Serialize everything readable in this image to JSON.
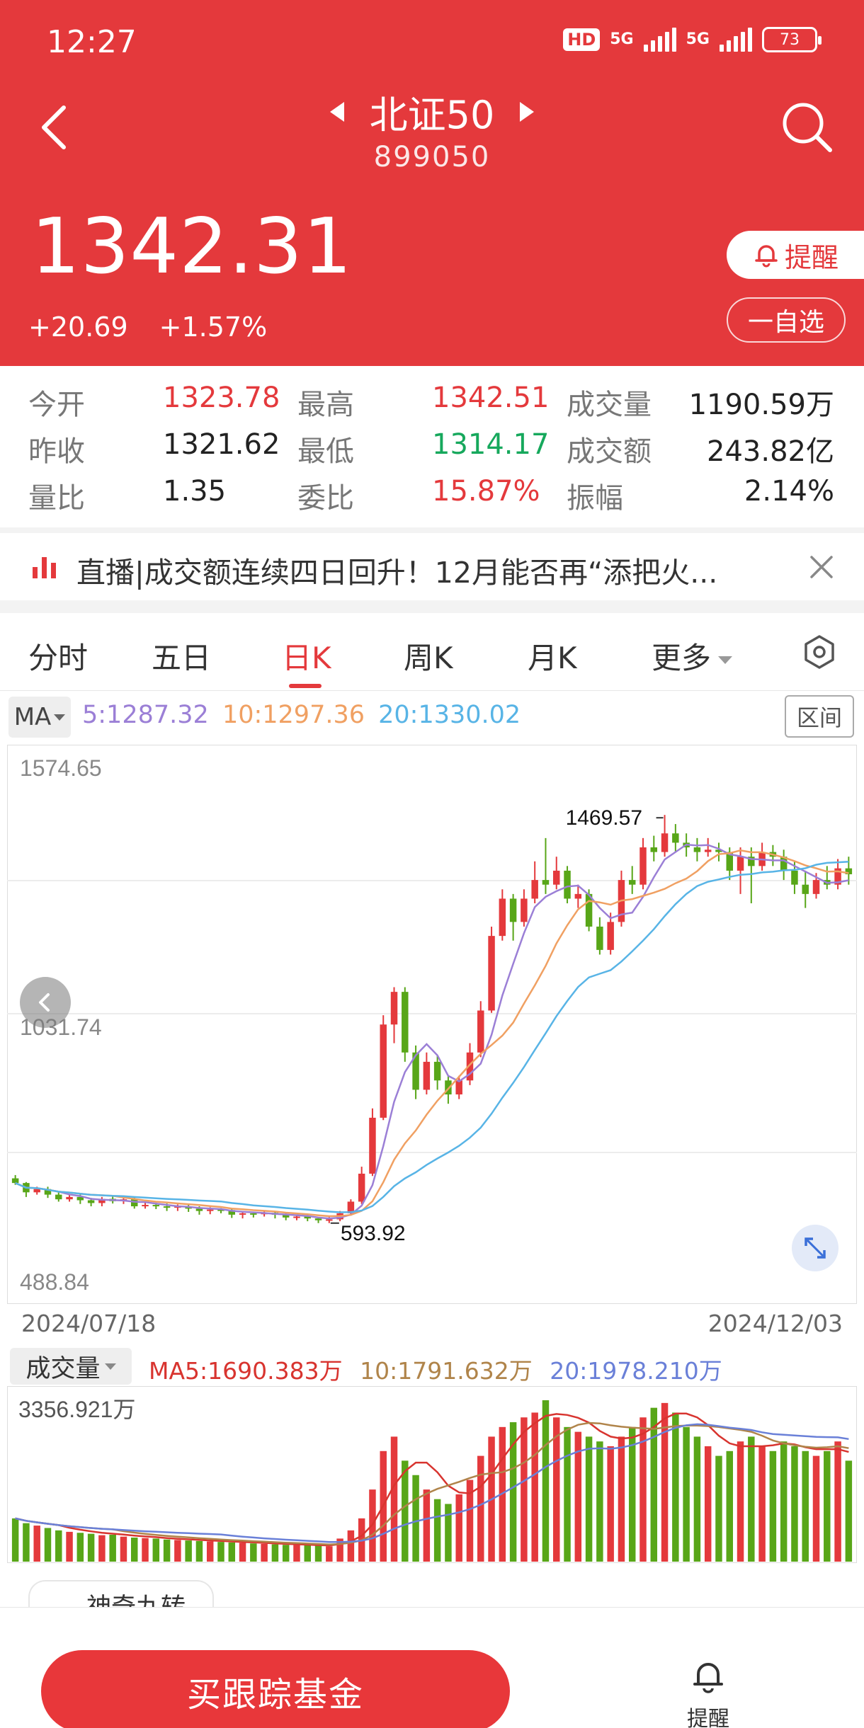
{
  "status": {
    "time": "12:27",
    "hd": "HD",
    "net1": "5G",
    "net2": "5G",
    "battery": "73"
  },
  "header": {
    "name": "北证50",
    "code": "899050",
    "price": "1342.31",
    "change": "+20.69",
    "change_pct": "+1.57%",
    "remind_label": "提醒",
    "watch_label": "一自选"
  },
  "stats": {
    "open_label": "今开",
    "open": "1323.78",
    "high_label": "最高",
    "high": "1342.51",
    "volume_label": "成交量",
    "volume": "1190.59万",
    "prev_label": "昨收",
    "prev": "1321.62",
    "low_label": "最低",
    "low": "1314.17",
    "amount_label": "成交额",
    "amount": "243.82亿",
    "ratio_label": "量比",
    "ratio": "1.35",
    "commit_label": "委比",
    "commit": "15.87%",
    "amp_label": "振幅",
    "amp": "2.14%"
  },
  "news": {
    "text": "直播|成交额连续四日回升！12月能否再“添把火..."
  },
  "tabs": [
    "分时",
    "五日",
    "日K",
    "周K",
    "月K",
    "更多"
  ],
  "ma": {
    "btn": "MA",
    "ma5": "5:1287.32",
    "ma10": "10:1297.36",
    "ma20": "20:1330.02",
    "range_btn": "区间"
  },
  "volume": {
    "btn": "成交量",
    "ma5": "MA5:1690.383万",
    "ma10": "10:1791.632万",
    "ma20": "20:1978.210万"
  },
  "colors": {
    "up": "#e4393c",
    "down": "#58a618",
    "ma5": "#9b7fd6",
    "ma10": "#f0a062",
    "ma20": "#58b4e6",
    "vma5": "#d8342f",
    "vma10": "#b0844a",
    "vma20": "#6a80d8",
    "seq": "#f0a040",
    "seq_done": "#e55a5a"
  },
  "chart_data": [
    {
      "type": "candlestick",
      "ylim": [
        488.84,
        1574.65
      ],
      "ytick_labels": [
        "1574.65",
        "1031.74",
        "488.84"
      ],
      "date_start": "2024/07/18",
      "date_end": "2024/12/03",
      "high_annotation": "1469.57",
      "low_annotation": "593.92",
      "candles": [
        [
          690,
          680,
          697,
          676
        ],
        [
          680,
          660,
          682,
          650
        ],
        [
          660,
          667,
          672,
          655
        ],
        [
          667,
          655,
          672,
          648
        ],
        [
          655,
          645,
          662,
          640
        ],
        [
          645,
          650,
          655,
          640
        ],
        [
          650,
          643,
          655,
          635
        ],
        [
          643,
          637,
          648,
          630
        ],
        [
          637,
          646,
          650,
          630
        ],
        [
          646,
          641,
          652,
          636
        ],
        [
          641,
          645,
          650,
          635
        ],
        [
          645,
          630,
          650,
          625
        ],
        [
          630,
          633,
          640,
          625
        ],
        [
          633,
          630,
          638,
          624
        ],
        [
          630,
          627,
          636,
          620
        ],
        [
          627,
          630,
          634,
          620
        ],
        [
          630,
          625,
          635,
          618
        ],
        [
          625,
          620,
          630,
          612
        ],
        [
          620,
          623,
          628,
          613
        ],
        [
          623,
          622,
          626,
          615
        ],
        [
          622,
          612,
          626,
          605
        ],
        [
          612,
          615,
          620,
          604
        ],
        [
          615,
          613,
          618,
          606
        ],
        [
          613,
          616,
          620,
          608
        ],
        [
          616,
          612,
          620,
          604
        ],
        [
          612,
          606,
          615,
          600
        ],
        [
          606,
          608,
          612,
          600
        ],
        [
          608,
          604,
          611,
          598
        ],
        [
          604,
          600,
          607,
          594
        ],
        [
          600,
          602,
          607,
          593.92
        ],
        [
          602,
          615,
          620,
          598
        ],
        [
          615,
          640,
          645,
          610
        ],
        [
          640,
          700,
          715,
          635
        ],
        [
          700,
          820,
          840,
          695
        ],
        [
          820,
          1020,
          1040,
          815
        ],
        [
          1020,
          1090,
          1100,
          980
        ],
        [
          1090,
          960,
          1100,
          940
        ],
        [
          960,
          880,
          975,
          860
        ],
        [
          880,
          940,
          960,
          870
        ],
        [
          940,
          900,
          955,
          880
        ],
        [
          900,
          870,
          910,
          850
        ],
        [
          870,
          900,
          910,
          860
        ],
        [
          900,
          960,
          980,
          890
        ],
        [
          960,
          1050,
          1070,
          950
        ],
        [
          1050,
          1210,
          1230,
          1045
        ],
        [
          1210,
          1290,
          1310,
          1200
        ],
        [
          1290,
          1240,
          1300,
          1200
        ],
        [
          1240,
          1290,
          1310,
          1230
        ],
        [
          1290,
          1330,
          1370,
          1280
        ],
        [
          1330,
          1320,
          1420,
          1300
        ],
        [
          1320,
          1350,
          1380,
          1310
        ],
        [
          1350,
          1290,
          1360,
          1280
        ],
        [
          1290,
          1300,
          1320,
          1270
        ],
        [
          1300,
          1230,
          1310,
          1220
        ],
        [
          1230,
          1180,
          1250,
          1170
        ],
        [
          1180,
          1240,
          1260,
          1170
        ],
        [
          1240,
          1330,
          1350,
          1230
        ],
        [
          1330,
          1320,
          1360,
          1300
        ],
        [
          1320,
          1400,
          1420,
          1310
        ],
        [
          1400,
          1390,
          1425,
          1370
        ],
        [
          1390,
          1430,
          1469.57,
          1380
        ],
        [
          1430,
          1410,
          1450,
          1390
        ],
        [
          1410,
          1400,
          1430,
          1380
        ],
        [
          1400,
          1390,
          1420,
          1370
        ],
        [
          1390,
          1395,
          1420,
          1380
        ],
        [
          1395,
          1390,
          1410,
          1370
        ],
        [
          1390,
          1350,
          1400,
          1330
        ],
        [
          1350,
          1380,
          1400,
          1300
        ],
        [
          1380,
          1360,
          1400,
          1280
        ],
        [
          1360,
          1390,
          1410,
          1350
        ],
        [
          1390,
          1380,
          1405,
          1360
        ],
        [
          1380,
          1350,
          1395,
          1330
        ],
        [
          1350,
          1320,
          1370,
          1300
        ],
        [
          1320,
          1300,
          1350,
          1270
        ],
        [
          1300,
          1330,
          1345,
          1290
        ],
        [
          1330,
          1320,
          1360,
          1310
        ],
        [
          1320,
          1355,
          1375,
          1310
        ],
        [
          1355,
          1342.31,
          1380,
          1320
        ]
      ]
    },
    {
      "type": "bar",
      "ylim": [
        0,
        3356.921
      ],
      "ytick_labels": [
        "3356.921万"
      ],
      "volumes": [
        900,
        800,
        750,
        700,
        650,
        620,
        600,
        580,
        550,
        560,
        520,
        500,
        490,
        480,
        460,
        450,
        440,
        430,
        420,
        410,
        400,
        390,
        380,
        370,
        360,
        350,
        345,
        340,
        330,
        320,
        480,
        650,
        900,
        1500,
        2300,
        2600,
        2100,
        1800,
        1500,
        1300,
        1200,
        1400,
        1700,
        2200,
        2600,
        2800,
        2900,
        3000,
        3100,
        3356.921,
        3000,
        2800,
        2700,
        2600,
        2500,
        2400,
        2600,
        2800,
        3000,
        3200,
        3300,
        3100,
        2800,
        2600,
        2400,
        2200,
        2300,
        2500,
        2600,
        2400,
        2300,
        2500,
        2400,
        2300,
        2200,
        2300,
        2500,
        2100
      ]
    }
  ],
  "bottom": {
    "magic_label": "神奇九转",
    "buy_label": "买跟踪基金",
    "remind_label": "提醒"
  }
}
